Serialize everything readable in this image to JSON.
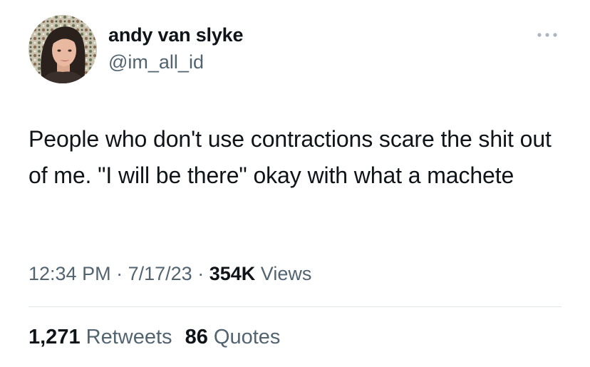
{
  "author": {
    "display_name": "andy van slyke",
    "handle": "@im_all_id"
  },
  "avatar_icon": "profile-photo",
  "more_icon": "more-horizontal-icon",
  "tweet": {
    "text": "People who don't use contractions scare the shit out of me. \"I will be there\" okay with what a machete"
  },
  "meta": {
    "time": "12:34 PM",
    "separator": "·",
    "date": "7/17/23",
    "views_count": "354K",
    "views_label": "Views"
  },
  "stats": {
    "retweets_count": "1,271",
    "retweets_label": "Retweets",
    "quotes_count": "86",
    "quotes_label": "Quotes"
  },
  "colors": {
    "text": "#0f1419",
    "secondary": "#536471",
    "divider": "#e1e6ea"
  }
}
